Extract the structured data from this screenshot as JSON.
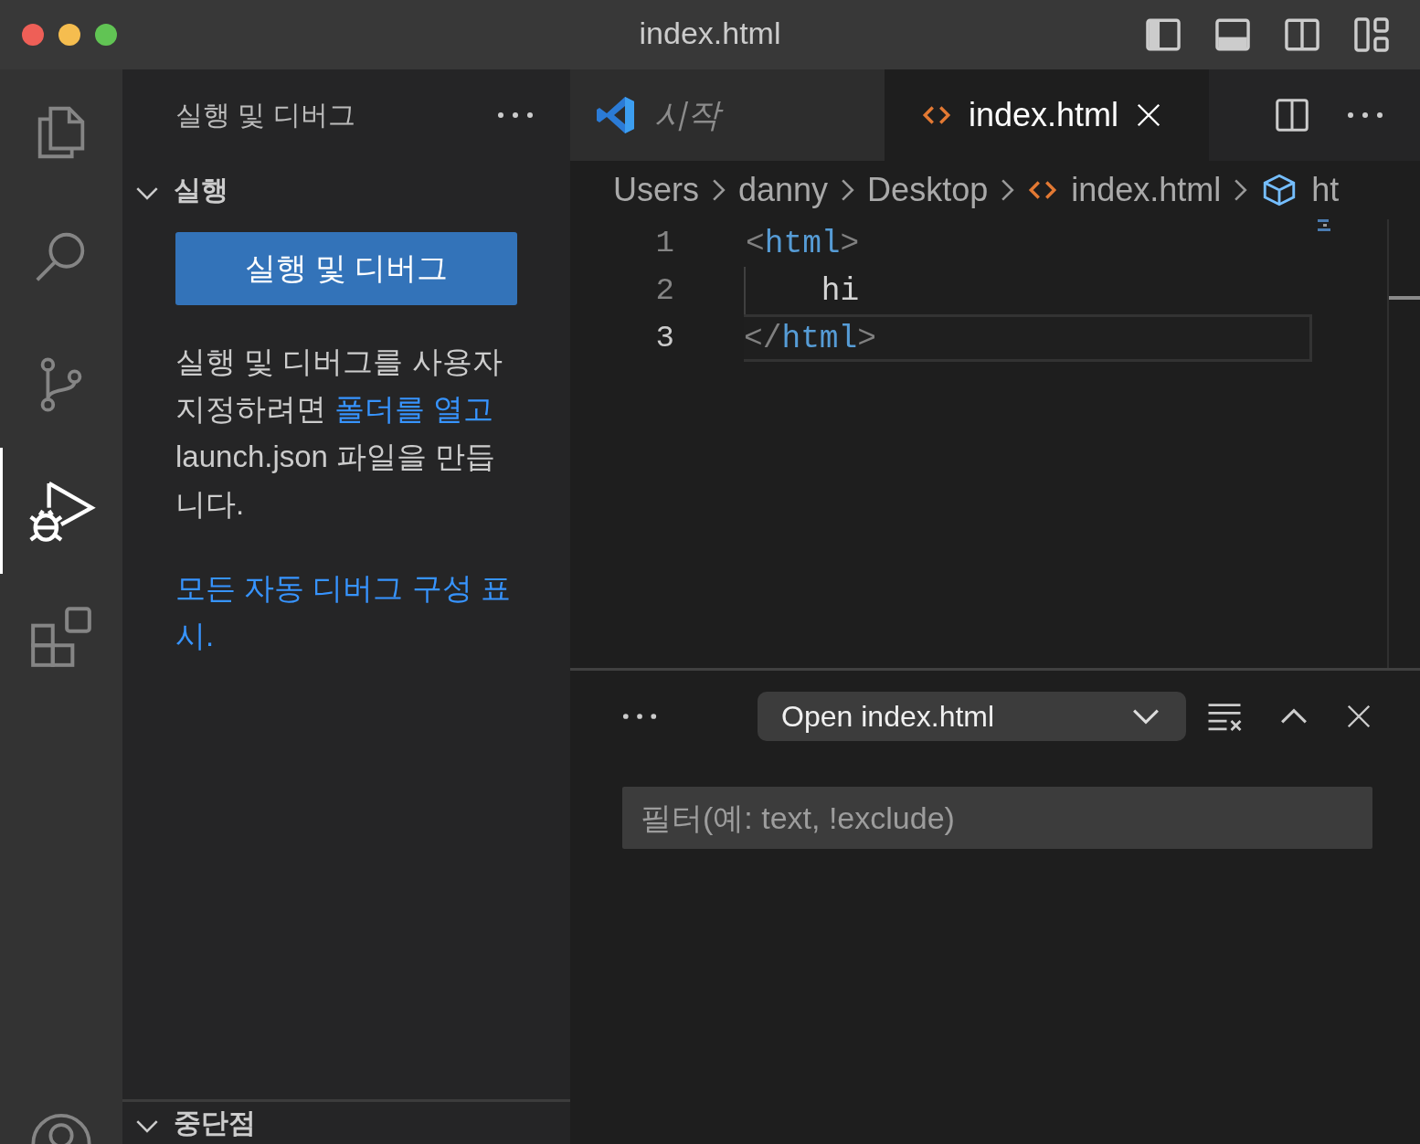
{
  "window": {
    "title": "index.html"
  },
  "activity_bar": {
    "items": [
      {
        "kind": "explorer",
        "selected": false
      },
      {
        "kind": "search",
        "selected": false
      },
      {
        "kind": "source-control",
        "selected": false
      },
      {
        "kind": "run-debug",
        "selected": true
      },
      {
        "kind": "extensions",
        "selected": false
      },
      {
        "kind": "account",
        "selected": false
      }
    ]
  },
  "sidebar": {
    "title": "실행 및 디버그",
    "sections": [
      {
        "title": "실행",
        "expanded": true,
        "button": "실행 및 디버그",
        "text_before": "실행 및 디버그를 사용자 지정하려면 ",
        "link": "폴더를 열고",
        "text_after": " launch.json 파일을 만듭니다.",
        "footer_link": "모든 자동 디버그 구성 표시."
      },
      {
        "title": "중단점",
        "expanded": true
      }
    ]
  },
  "editor": {
    "tabs": [
      {
        "label": "시작",
        "kind": "welcome",
        "selected": false
      },
      {
        "label": "index.html",
        "kind": "html",
        "selected": true
      }
    ],
    "breadcrumbs": [
      {
        "label": "Users",
        "kind": "folder"
      },
      {
        "label": "danny",
        "kind": "folder"
      },
      {
        "label": "Desktop",
        "kind": "folder"
      },
      {
        "label": "index.html",
        "kind": "html"
      },
      {
        "label": "ht",
        "kind": "symbol"
      }
    ],
    "lines": [
      {
        "number": "1",
        "code": "<html>",
        "current": false
      },
      {
        "number": "2",
        "code": "    hi",
        "current": false
      },
      {
        "number": "3",
        "code": "</html>",
        "current": true
      }
    ]
  },
  "panel": {
    "dropdown": "Open index.html",
    "filter": {
      "placeholder": "필터(예: text, !exclude)"
    }
  }
}
